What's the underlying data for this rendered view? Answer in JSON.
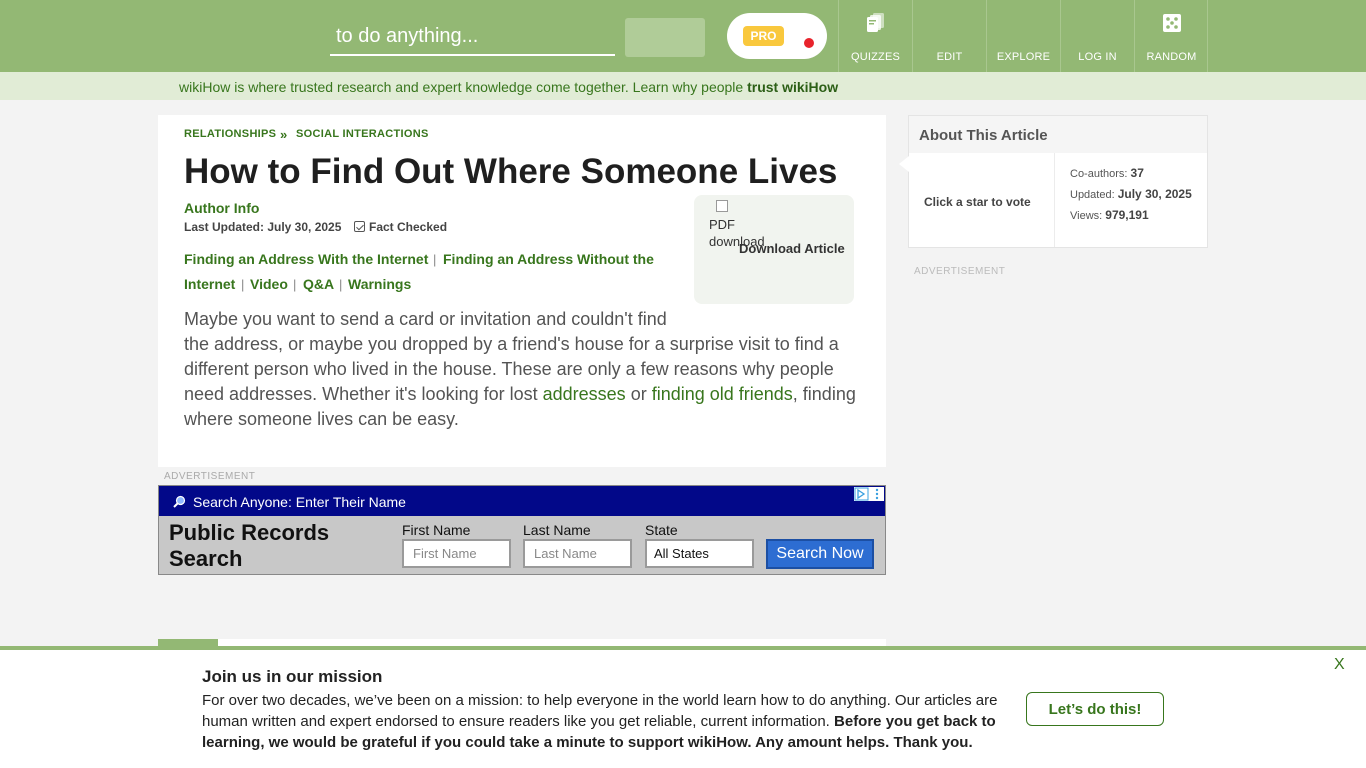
{
  "header": {
    "search_placeholder": "to do anything...",
    "pro_label": "PRO",
    "nav": [
      {
        "label": "QUIZZES",
        "icon": "quizzes-icon"
      },
      {
        "label": "EDIT",
        "icon": ""
      },
      {
        "label": "EXPLORE",
        "icon": ""
      },
      {
        "label": "LOG IN",
        "icon": ""
      },
      {
        "label": "RANDOM",
        "icon": "dice-icon"
      }
    ]
  },
  "trust_bar": {
    "text": "wikiHow is where trusted research and expert knowledge come together. Learn why people ",
    "link": "trust wikiHow"
  },
  "article": {
    "breadcrumb": [
      "RELATIONSHIPS",
      "SOCIAL INTERACTIONS"
    ],
    "breadcrumb_sep": "»",
    "title": "How to Find Out Where Someone Lives",
    "author_info": "Author Info",
    "last_updated": "Last Updated: July 30, 2025",
    "fact_checked": "Fact Checked",
    "toc": [
      "Finding an Address With the Internet",
      "Finding an Address Without the",
      "Internet",
      "Video",
      "Q&A",
      "Warnings"
    ],
    "toc_sep": "|",
    "download": {
      "img_alt": "PDF download",
      "label": "Download Article"
    },
    "intro": {
      "line1": "Maybe you want to send a card or invitation and couldn't find",
      "line2": "the address, or maybe you dropped by a friend's house for a surprise visit to find a",
      "line3": "different person who lived in the house. These are only a few reasons why people",
      "line4_a": "need addresses. Whether it's looking for lost ",
      "link1": "addresses",
      "line4_b": " or ",
      "link2": "finding old friends",
      "line4_c": ", finding",
      "line5": "where someone lives can be easy."
    },
    "ad_label": "ADVERTISEMENT"
  },
  "ad": {
    "bar_text": "Search Anyone: Enter Their Name",
    "title_line1": "Public Records",
    "title_line2": "Search",
    "first_name_label": "First Name",
    "first_name_placeholder": "First Name",
    "last_name_label": "Last Name",
    "last_name_placeholder": "Last Name",
    "state_label": "State",
    "state_value": "All States",
    "button": "Search Now"
  },
  "sidebar": {
    "about_title": "About This Article",
    "vote": "Click a star to vote",
    "coauthors_label": "Co-authors:",
    "coauthors_value": "37",
    "updated_label": "Updated:",
    "updated_value": "July 30, 2025",
    "views_label": "Views:",
    "views_value": "979,191",
    "ad_label": "ADVERTISEMENT"
  },
  "mission": {
    "title": "Join us in our mission",
    "line1": "For over two decades, we’ve been on a mission: to help everyone in the world learn how to do anything. Our articles are",
    "line2_a": "human written and expert endorsed to ensure readers like you get reliable, current information. ",
    "line2_b": "Before you get back to",
    "line3": "learning, we would be grateful if you could take a minute to support wikiHow. Any amount helps. Thank you.",
    "button": "Let’s do this!",
    "close": "X"
  },
  "colors": {
    "brand_green": "#93b874",
    "link_green": "#38761d",
    "ad_blue": "#020889"
  }
}
